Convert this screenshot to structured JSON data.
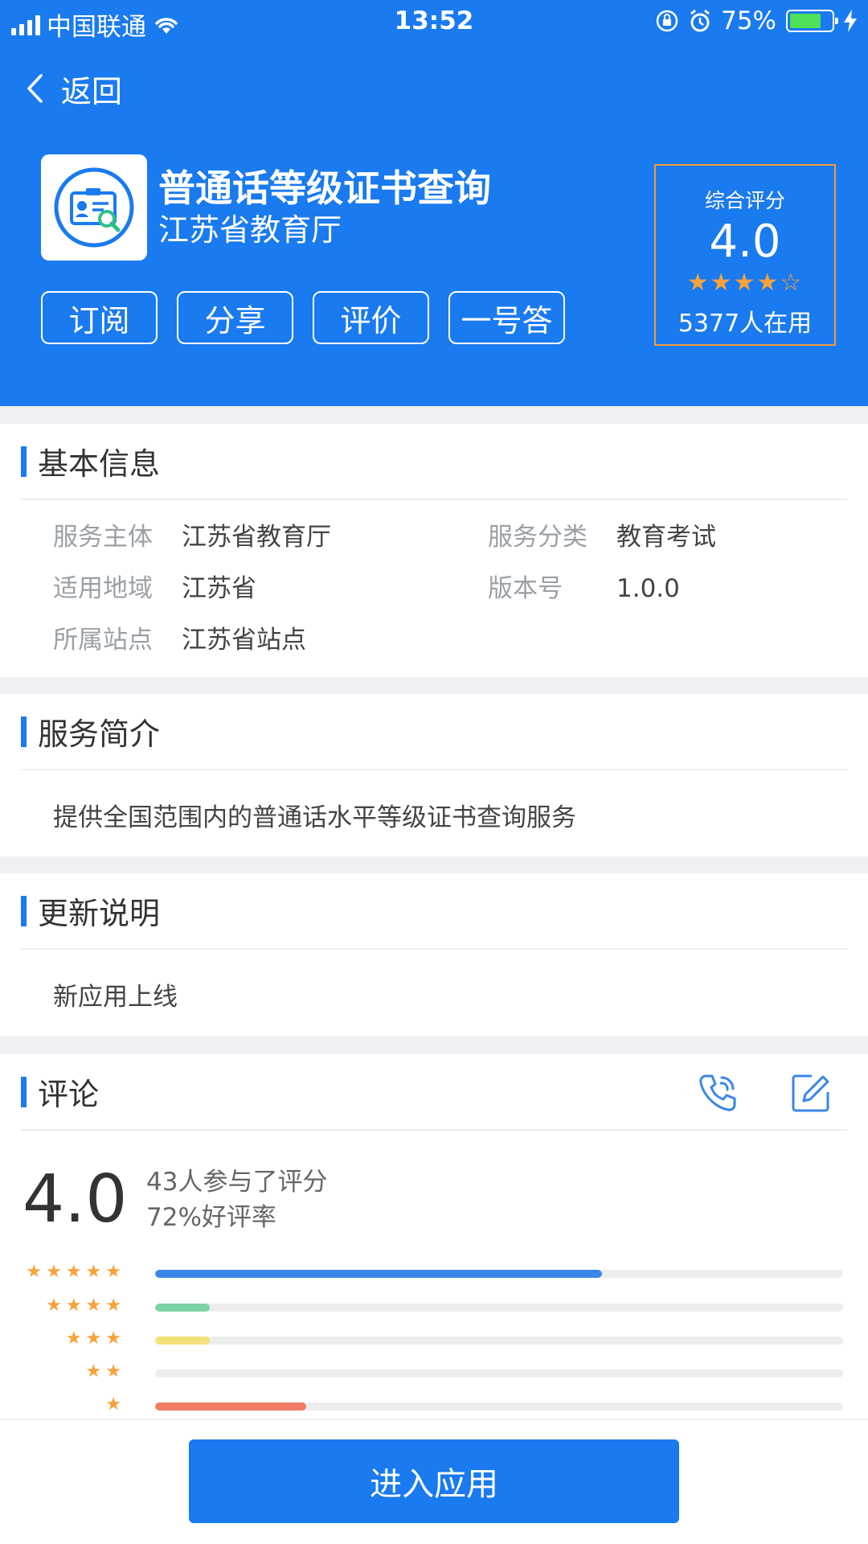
{
  "status_bar": {
    "carrier": "中国联通",
    "time": "13:52",
    "battery": "75%",
    "battery_level": 0.75
  },
  "header": {
    "back_label": "返回"
  },
  "app": {
    "title": "普通话等级证书查询",
    "org": "江苏省教育厅"
  },
  "actions": [
    "订阅",
    "分享",
    "评价",
    "一号答"
  ],
  "rating_box": {
    "label": "综合评分",
    "score": "4.0",
    "stars": "★★★★☆",
    "users": "5377人在用"
  },
  "basic_info": {
    "title": "基本信息",
    "rows": [
      {
        "key": "服务主体",
        "value": "江苏省教育厅"
      },
      {
        "key": "服务分类",
        "value": "教育考试"
      },
      {
        "key": "适用地域",
        "value": "江苏省"
      },
      {
        "key": "版本号",
        "value": "1.0.0"
      },
      {
        "key": "所属站点",
        "value": "江苏省站点"
      }
    ]
  },
  "intro": {
    "title": "服务简介",
    "text": "提供全国范围内的普通话水平等级证书查询服务"
  },
  "update": {
    "title": "更新说明",
    "text": "新应用上线"
  },
  "comments": {
    "title": "评论",
    "score": "4.0",
    "participants": "43人参与了评分",
    "positive_rate": "72%好评率",
    "distribution": [
      {
        "stars": "★★★★★",
        "fraction": 0.65,
        "color": "#3a87e8"
      },
      {
        "stars": "★★★★",
        "fraction": 0.08,
        "color": "#7dd3a6"
      },
      {
        "stars": "★★★",
        "fraction": 0.08,
        "color": "#f3e27a"
      },
      {
        "stars": "★★",
        "fraction": 0.0,
        "color": "#cccccc"
      },
      {
        "stars": "★",
        "fraction": 0.22,
        "color": "#ef7b62"
      }
    ]
  },
  "bottom": {
    "enter_label": "进入应用"
  },
  "colors": {
    "primary": "#1a7aef",
    "rating_border": "#f39a3b",
    "star": "#f7a23b"
  }
}
